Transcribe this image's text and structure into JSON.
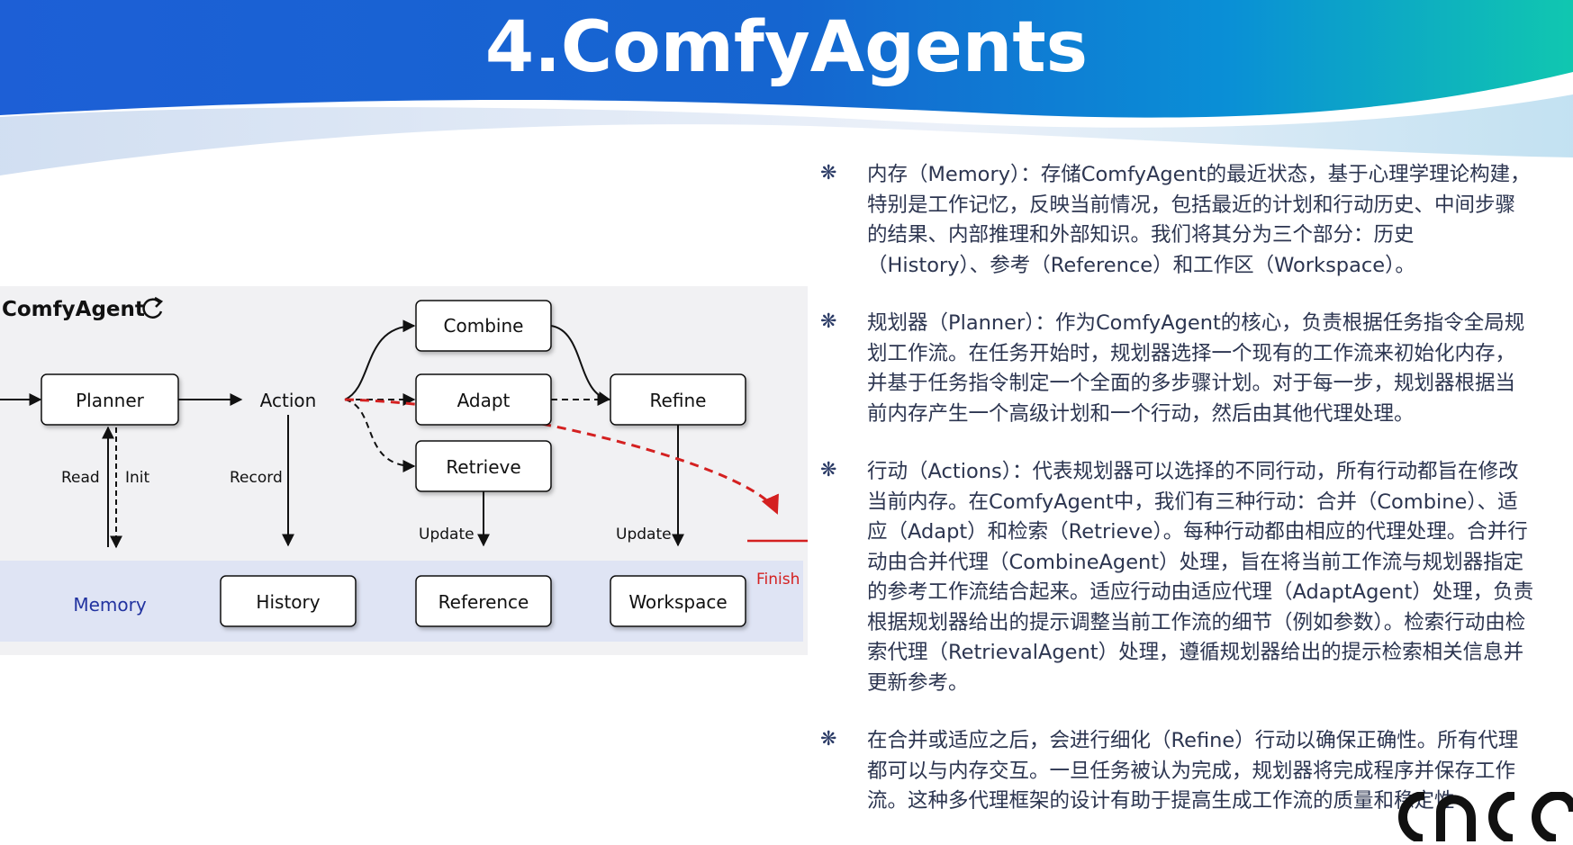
{
  "slide": {
    "title": "4.ComfyAgents"
  },
  "diagram": {
    "title": "ComfyAgent",
    "nodes": {
      "planner": "Planner",
      "action": "Action",
      "combine": "Combine",
      "adapt": "Adapt",
      "retrieve": "Retrieve",
      "refine": "Refine",
      "memory": "Memory",
      "history": "History",
      "reference": "Reference",
      "workspace": "Workspace"
    },
    "edge_labels": {
      "read": "Read",
      "init": "Init",
      "record": "Record",
      "update_reference": "Update",
      "update_workspace": "Update",
      "finish": "Finish"
    },
    "colors": {
      "finish_arrow": "#d42020",
      "memory_band": "#dfe4f4",
      "memory_text": "#2233a0"
    }
  },
  "text_panel": {
    "bullet_icon": "asterisk-bullet-icon",
    "paragraphs": [
      "内存（Memory）：存储ComfyAgent的最近状态，基于心理学理论构建，特别是工作记忆，反映当前情况，包括最近的计划和行动历史、中间步骤的结果、内部推理和外部知识。我们将其分为三个部分：历史（History）、参考（Reference）和工作区（Workspace）。",
      "规划器（Planner）：作为ComfyAgent的核心，负责根据任务指令全局规划工作流。在任务开始时，规划器选择一个现有的工作流来初始化内存，并基于任务指令制定一个全面的多步骤计划。对于每一步，规划器根据当前内存产生一个高级计划和一个行动，然后由其他代理处理。",
      "行动（Actions）：代表规划器可以选择的不同行动，所有行动都旨在修改当前内存。在ComfyAgent中，我们有三种行动：合并（Combine）、适应（Adapt）和检索（Retrieve）。每种行动都由相应的代理处理。合并行动由合并代理（CombineAgent）处理，旨在将当前工作流与规划器指定的参考工作流结合起来。适应行动由适应代理（AdaptAgent）处理，负责根据规划器给出的提示调整当前工作流的细节（例如参数）。检索行动由检索代理（RetrievalAgent）处理，遵循规划器给出的提示检索相关信息并更新参考。",
      "在合并或适应之后，会进行细化（Refine）行动以确保正确性。所有代理都可以与内存交互。一旦任务被认为完成，规划器将完成程序并保存工作流。这种多代理框架的设计有助于提高生成工作流的质量和稳定性"
    ]
  }
}
